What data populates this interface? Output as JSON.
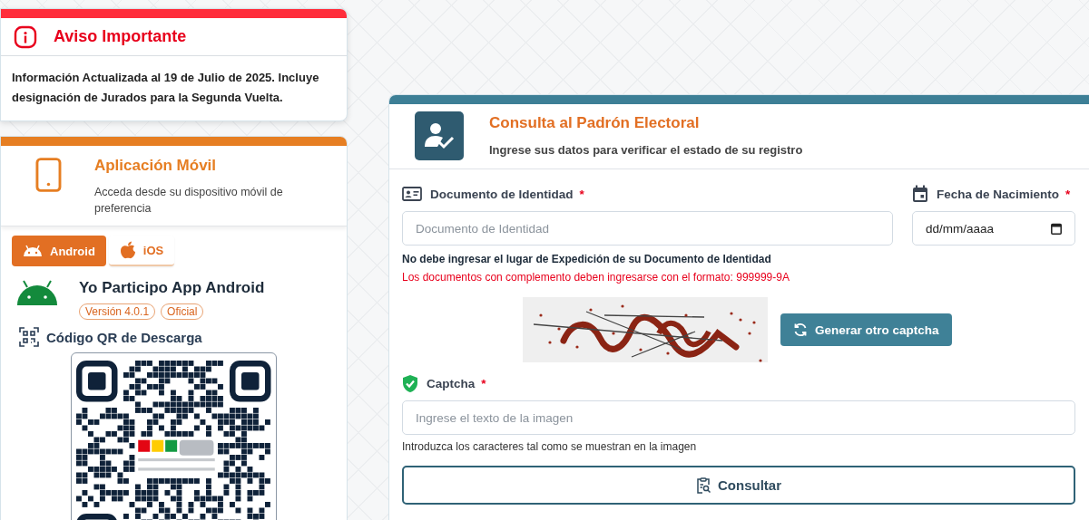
{
  "notice": {
    "title": "Aviso Importante",
    "text": "Información Actualizada al 19 de Julio de 2025. Incluye designación de Jurados para la Segunda Vuelta."
  },
  "mobile_app": {
    "title": "Aplicación Móvil",
    "subtitle": "Acceda desde su dispositivo móvil de preferencia",
    "tabs": [
      {
        "label": "Android",
        "kind": "android",
        "selected": true
      },
      {
        "label": "iOS",
        "kind": "ios",
        "selected": false
      }
    ],
    "app_name": "Yo Participo App Android",
    "badges": [
      "Versión 4.0.1",
      "Oficial"
    ],
    "qr_title": "Código QR de Descarga"
  },
  "query_form": {
    "title": "Consulta al Padrón Electoral",
    "subtitle": "Ingrese sus datos para verificar el estado de su registro",
    "document_field": {
      "label": "Documento de Identidad",
      "required_mark": "*",
      "placeholder": "Documento de Identidad"
    },
    "birth_date_field": {
      "label": "Fecha de Nacimiento",
      "required_mark": "*",
      "placeholder": "dd/mm/aaaa"
    },
    "note": "No debe ingresar el lugar de Expedición de su Documento de Identidad",
    "warning": "Los documentos con complemento deben ingresarse con el formato: 999999-9A",
    "refresh_button": "Generar otro captcha",
    "captcha_field": {
      "label": "Captcha",
      "required_mark": "*",
      "placeholder": "Ingrese el texto de la imagen",
      "help": "Introduzca los caracteres tal como se muestran en la imagen"
    },
    "submit_button": "Consultar"
  }
}
